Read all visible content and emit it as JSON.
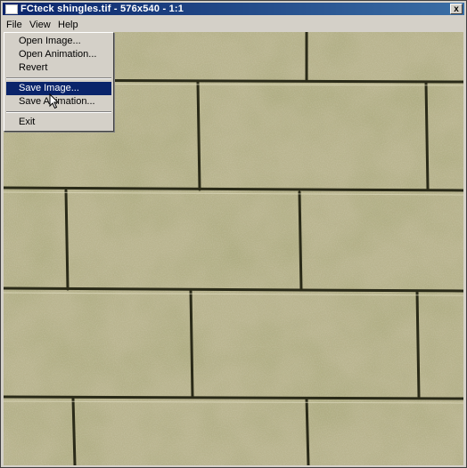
{
  "window": {
    "title": "FCteck shingles.tif - 576x540 - 1:1",
    "close_label": "x"
  },
  "menubar": {
    "items": [
      {
        "label": "File"
      },
      {
        "label": "View"
      },
      {
        "label": "Help"
      }
    ]
  },
  "file_menu": {
    "items": [
      {
        "label": "Open Image..."
      },
      {
        "label": "Open Animation..."
      },
      {
        "label": "Revert"
      },
      {
        "label": "Save Image..."
      },
      {
        "label": "Save Animation..."
      },
      {
        "label": "Exit"
      }
    ],
    "selected_index": 3
  },
  "image": {
    "content": "shingle-roof-texture",
    "base_color": "#b5b08a",
    "grout_color": "#2a2a18"
  },
  "colors": {
    "titlebar_start": "#0a246a",
    "titlebar_end": "#3a6ea5",
    "menu_highlight": "#0a246a",
    "chrome": "#d4d0c8"
  }
}
